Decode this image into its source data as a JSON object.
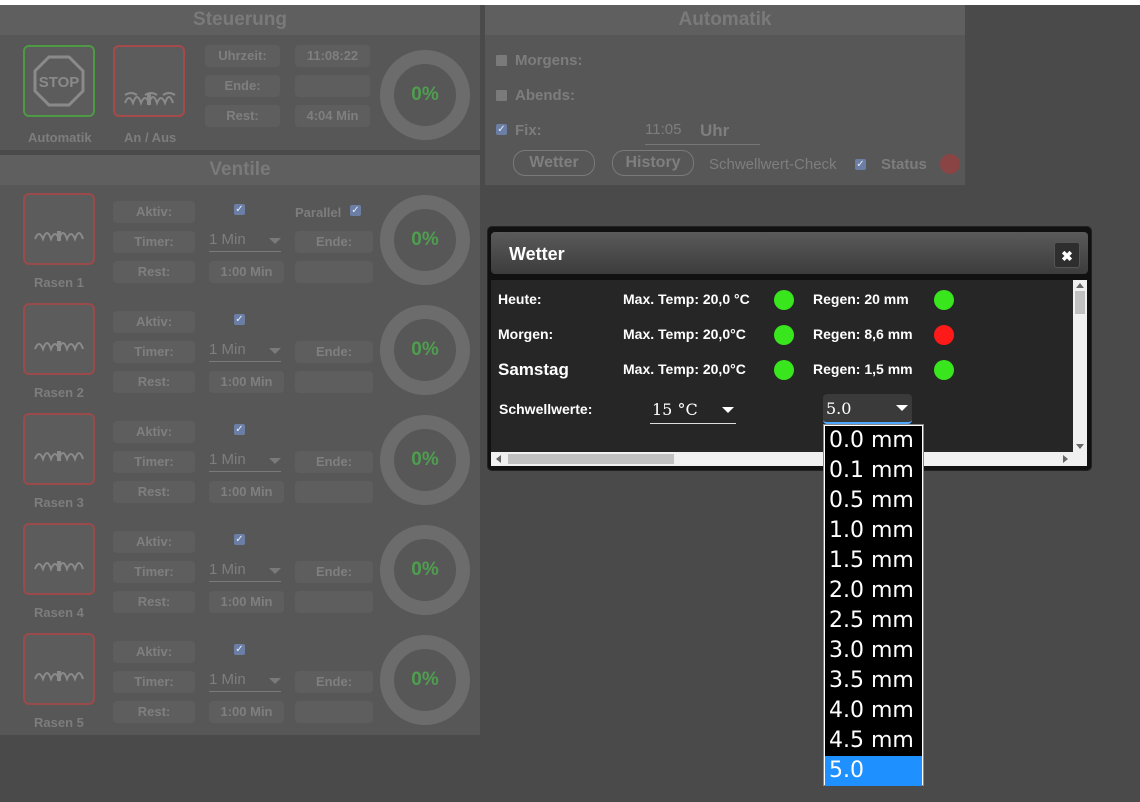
{
  "steuerung": {
    "title": "Steuerung",
    "stop_label": "STOP",
    "automatik_label": "Automatik",
    "anaus_label": "An / Aus",
    "uhrzeit_label": "Uhrzeit:",
    "uhrzeit_value": "11:08:22",
    "ende_label": "Ende:",
    "ende_value": "",
    "rest_label": "Rest:",
    "rest_value": "4:04 Min",
    "progress": "0%"
  },
  "automatik": {
    "title": "Automatik",
    "morgens_label": "Morgens:",
    "abends_label": "Abends:",
    "fix_label": "Fix:",
    "fix_time": "11:05",
    "fix_unit": "Uhr",
    "wetter_button": "Wetter",
    "history_button": "History",
    "schwellwert_label": "Schwellwert-Check",
    "status_label": "Status"
  },
  "ventile": {
    "title": "Ventile",
    "aktiv_label": "Aktiv:",
    "timer_label": "Timer:",
    "rest_label": "Rest:",
    "ende_label": "Ende:",
    "parallel_label": "Parallel",
    "items": [
      {
        "name": "Rasen 1",
        "timer": "1 Min",
        "rest": "1:00 Min",
        "progress": "0%"
      },
      {
        "name": "Rasen 2",
        "timer": "1 Min",
        "rest": "1:00 Min",
        "progress": "0%"
      },
      {
        "name": "Rasen 3",
        "timer": "1 Min",
        "rest": "1:00 Min",
        "progress": "0%"
      },
      {
        "name": "Rasen 4",
        "timer": "1 Min",
        "rest": "1:00 Min",
        "progress": "0%"
      },
      {
        "name": "Rasen 5",
        "timer": "1 Min",
        "rest": "1:00 Min",
        "progress": "0%"
      }
    ]
  },
  "wetter_dialog": {
    "title": "Wetter",
    "close_icon": "close-icon",
    "rows": [
      {
        "day": "Heute:",
        "temp": "Max. Temp: 20,0 °C",
        "temp_status": "#39e61e",
        "rain": "Regen: 20 mm",
        "rain_status": "#39e61e"
      },
      {
        "day": "Morgen:",
        "temp": "Max. Temp: 20,0°C",
        "temp_status": "#39e61e",
        "rain": "Regen: 8,6 mm",
        "rain_status": "#ff1a1a"
      },
      {
        "day": "Samstag",
        "temp": "Max. Temp: 20,0°C",
        "temp_status": "#39e61e",
        "rain": "Regen: 1,5 mm",
        "rain_status": "#39e61e"
      }
    ],
    "schwellwerte_label": "Schwellwerte:",
    "temp_select": "15 °C",
    "rain_select": "5.0"
  },
  "rain_options": [
    "0.0 mm",
    "0.1 mm",
    "0.5 mm",
    "1.0 mm",
    "1.5 mm",
    "2.0 mm",
    "2.5 mm",
    "3.0 mm",
    "3.5 mm",
    "4.0 mm",
    "4.5 mm",
    "5.0"
  ],
  "rain_selected_index": 11,
  "colors": {
    "progress_text": "#4f9e4f",
    "status_red": "#c0392b",
    "dropdown_selected": "#1e90ff"
  }
}
